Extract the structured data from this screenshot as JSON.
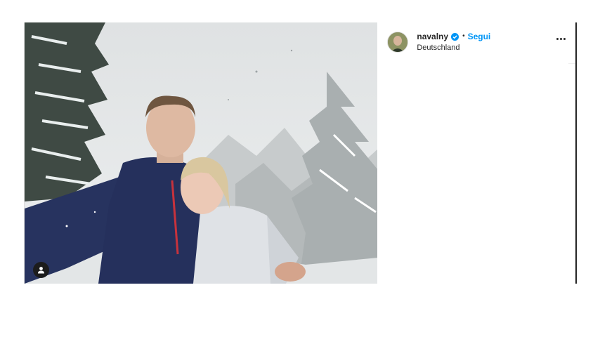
{
  "post": {
    "username": "navalny",
    "verified": true,
    "separator": "•",
    "follow_label": "Segui",
    "location": "Deutschland"
  },
  "icons": {
    "tagged_users": "person-icon",
    "more_options": "more-horizontal-icon",
    "verified": "verified-badge-icon"
  },
  "colors": {
    "link_blue": "#0095f6",
    "text": "#262626"
  }
}
